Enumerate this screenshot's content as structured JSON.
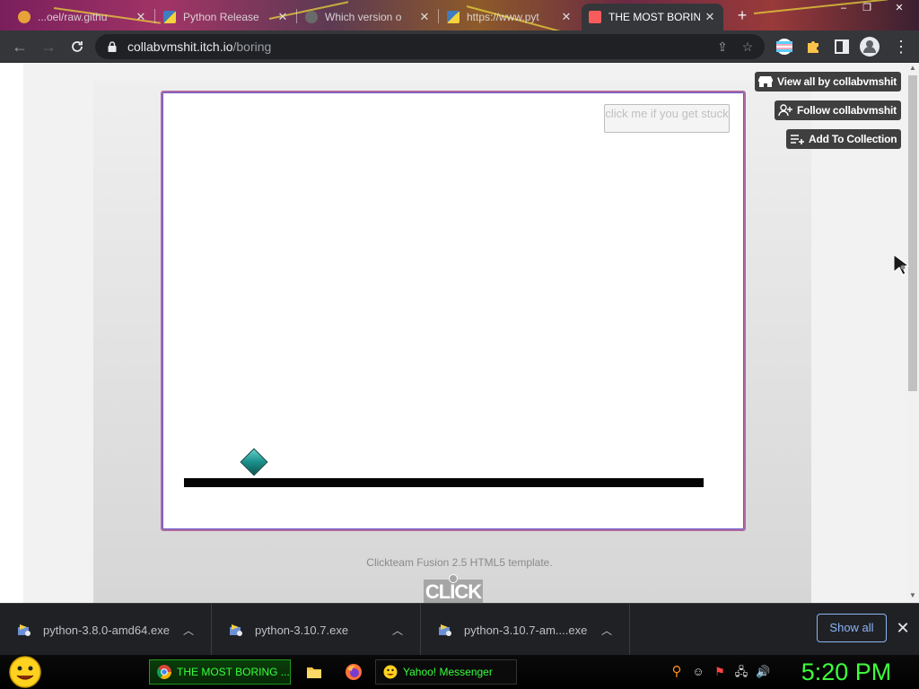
{
  "browser": {
    "tabs": [
      {
        "title": "...oel/raw.githu",
        "favicon_color": "#e8a23a",
        "active": false
      },
      {
        "title": "Python Release",
        "favicon_color": "#3f7cc0",
        "active": false
      },
      {
        "title": "Which version o",
        "favicon_color": "#6a6a6a",
        "active": false
      },
      {
        "title": "https://www.pyt",
        "favicon_color": "#3f7cc0",
        "active": false
      },
      {
        "title": "THE MOST BORING",
        "favicon_color": "#fa5c5c",
        "active": true
      }
    ],
    "tab_close_glyph": "✕",
    "new_tab_glyph": "+",
    "window_buttons": [
      "–",
      "❐",
      "✕"
    ],
    "address": {
      "host": "collabvmshit.itch.io",
      "path": "/boring"
    }
  },
  "itch": {
    "view_all": "View all by collabvmshit",
    "follow": "Follow collabvmshit",
    "add_to_collection": "Add To Collection"
  },
  "game": {
    "stuck_button": "click me if you get stuck",
    "template_caption": "Clickteam Fusion 2.5 HTML5 template.",
    "logo_text": "CLICK"
  },
  "downloads": {
    "items": [
      {
        "name": "python-3.8.0-amd64.exe"
      },
      {
        "name": "python-3.10.7.exe"
      },
      {
        "name": "python-3.10.7-am....exe"
      }
    ],
    "show_all": "Show all",
    "close_glyph": "✕"
  },
  "taskbar": {
    "tasks": [
      {
        "label": "THE MOST BORING ...",
        "icon": "chrome-icon"
      },
      {
        "label": "Yahoo! Messenger",
        "icon": "yahoo-messenger-icon"
      }
    ],
    "clock": "5:20 PM"
  },
  "colors": {
    "active_tab": "#35363a",
    "itch_button": "#3f3f3f",
    "player": "#1a8f8a",
    "taskbar_text": "#39ff3c",
    "show_all": "#8ab4f8"
  }
}
